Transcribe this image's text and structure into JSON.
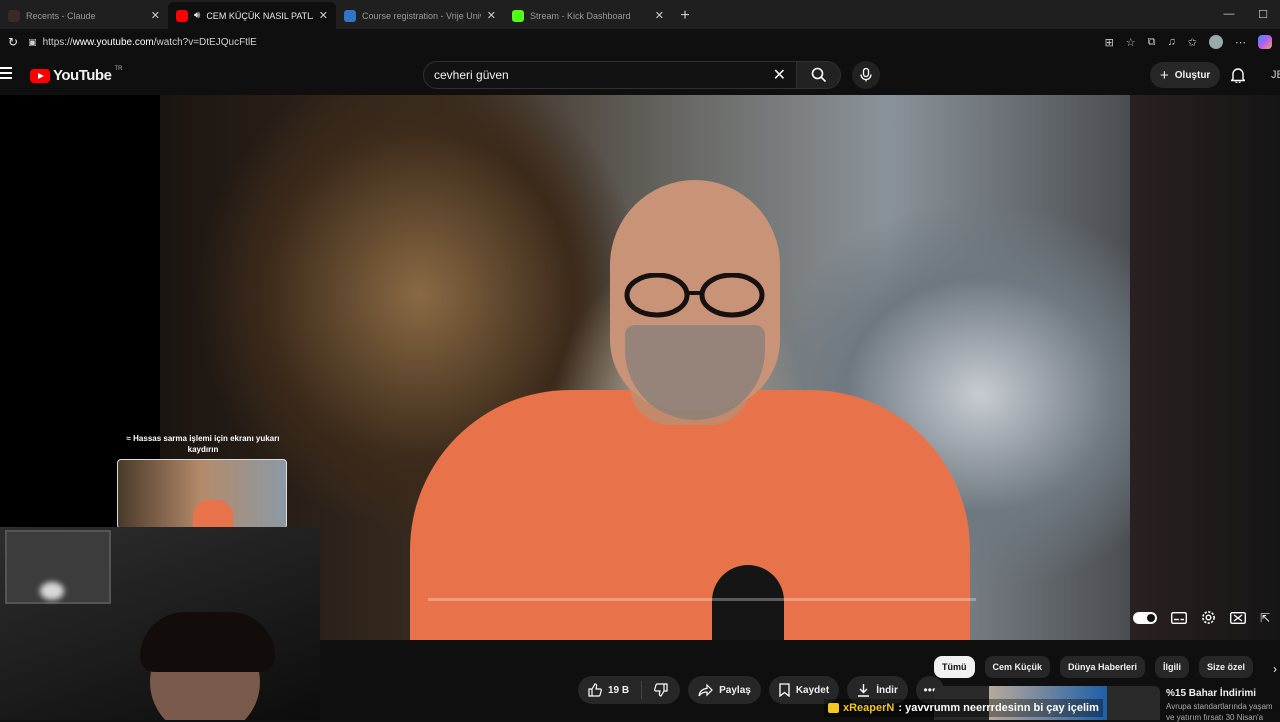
{
  "browser": {
    "tabs": [
      {
        "title": "Recents - Claude",
        "favicon_color": "#3a2a2a"
      },
      {
        "title": "CEM KÜÇÜK NASIL PATLADI",
        "favicon_color": "#ff0000"
      },
      {
        "title": "Course registration - Vrije Universit",
        "favicon_color": "#2f76c9"
      },
      {
        "title": "Stream - Kick Dashboard",
        "favicon_color": "#53fc18"
      }
    ],
    "new_tab": "+",
    "url_prefix": "https://",
    "url_host": "www.youtube.com",
    "url_path": "/watch?v=DtEJQucFtlE"
  },
  "youtube": {
    "logo_word": "YouTube",
    "country_code": "TR",
    "search_value": "cevheri güven",
    "create_label": "Oluştur",
    "account_letter": "JE"
  },
  "video": {
    "overlay_hint": "≈ Hassas sarma işlemi için ekranı yukarı kaydırın",
    "progress_fraction": 0.0
  },
  "actions": {
    "like_count": "19 B",
    "share": "Paylaş",
    "save": "Kaydet",
    "download": "İndir"
  },
  "chips": [
    "Tümü",
    "Cem Küçük",
    "Dünya Haberleri",
    "İlgili",
    "Size özel"
  ],
  "recommendation": {
    "title": "%15 Bahar İndirimi",
    "subtitle": "Avrupa standartlarında yaşam",
    "subtitle2": "ve yatırım fırsatı 30 Nisan'a"
  },
  "chat": {
    "user": "xReaperN",
    "message": ": yavvrumm neerrrdesinn bi çay içelim"
  },
  "colors": {
    "accent": "#ff0000",
    "kick_yellow": "#f3c623",
    "shirt": "#e8734a"
  }
}
